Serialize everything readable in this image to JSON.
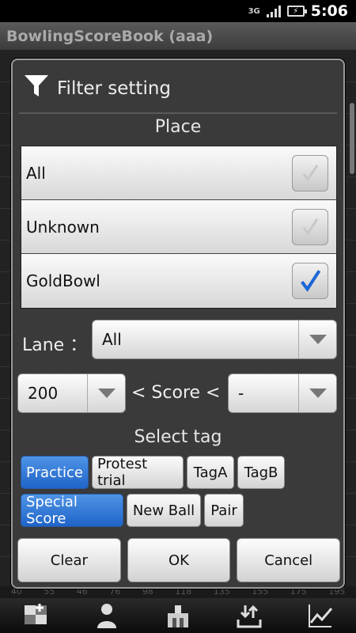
{
  "status_bar": {
    "network": "3G",
    "time": "5:06"
  },
  "app": {
    "title": "BowlingScoreBook (aaa)"
  },
  "background_strip": [
    "40",
    "55",
    "46",
    "76",
    "98",
    "118",
    "135",
    "155",
    "175",
    "195"
  ],
  "dialog": {
    "title": "Filter setting",
    "title_icon": "filter-funnel-icon",
    "place": {
      "heading": "Place",
      "items": [
        {
          "label": "All",
          "checked": false
        },
        {
          "label": "Unknown",
          "checked": false
        },
        {
          "label": "GoldBowl",
          "checked": true
        }
      ]
    },
    "lane": {
      "label": "Lane ：",
      "value": "All"
    },
    "score": {
      "min": "200",
      "label": "< Score <",
      "max": "-"
    },
    "tags": {
      "heading": "Select tag",
      "row1": [
        {
          "label": "Practice",
          "selected": true
        },
        {
          "label": "Protest trial",
          "selected": false
        },
        {
          "label": "TagA",
          "selected": false
        },
        {
          "label": "TagB",
          "selected": false
        }
      ],
      "row2": [
        {
          "label": "Special Score",
          "selected": true
        },
        {
          "label": "New Ball",
          "selected": false
        },
        {
          "label": "Pair",
          "selected": false
        }
      ]
    },
    "buttons": {
      "clear": "Clear",
      "ok": "OK",
      "cancel": "Cancel"
    }
  },
  "toolbar": {
    "icons": [
      "add-game-icon",
      "player-icon",
      "bowling-alley-icon",
      "import-export-icon",
      "stats-chart-icon"
    ]
  },
  "colors": {
    "selected_tag": "#2f78d8",
    "check_blue": "#1a66d6",
    "dialog_bg": "#3a3a3a"
  }
}
